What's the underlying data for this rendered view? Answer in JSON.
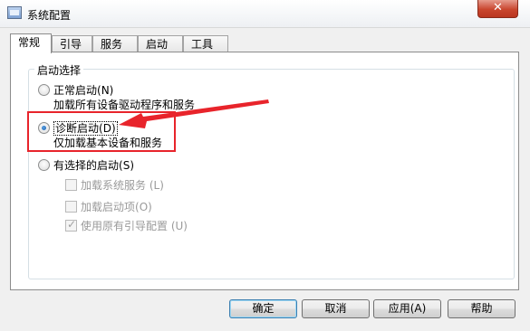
{
  "window": {
    "title": "系统配置",
    "close_label": "✕"
  },
  "tabs": [
    "常规",
    "引导",
    "服务",
    "启动",
    "工具"
  ],
  "startup": {
    "group_label": "启动选择",
    "normal": {
      "label": "正常启动",
      "key": "(N)",
      "desc": "加载所有设备驱动程序和服务",
      "checked": false
    },
    "diagnostic": {
      "label": "诊断启动",
      "key": "(D)",
      "desc": "仅加载基本设备和服务",
      "checked": true
    },
    "selective": {
      "label": "有选择的启动",
      "key": "(S)",
      "checked": false,
      "options": [
        {
          "label": "加载系统服务",
          "key": "(L)",
          "checked": false
        },
        {
          "label": "加载启动项",
          "key": "(O)",
          "checked": false
        },
        {
          "label": "使用原有引导配置",
          "key": "(U)",
          "checked": true
        }
      ]
    }
  },
  "buttons": {
    "ok": "确定",
    "cancel": "取消",
    "apply": "应用(A)",
    "help": "帮助"
  },
  "annotation": {
    "color": "#e8242b"
  }
}
